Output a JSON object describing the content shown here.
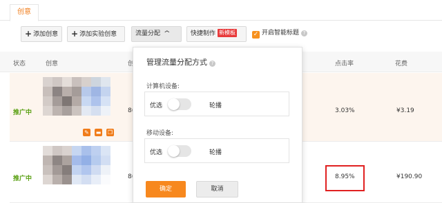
{
  "tabs": {
    "active": "创意"
  },
  "toolbar": {
    "add_creative": "添加创意",
    "add_experiment": "添加实验创意",
    "traffic_split": "流量分配",
    "quick_make": "快捷制作",
    "new_template_badge": "新模板",
    "smart_title": "开启智能标题"
  },
  "table": {
    "headers": {
      "status": "状态",
      "creative": "创意",
      "col_c": "创",
      "ctr": "点击率",
      "cost": "花费"
    },
    "rows": [
      {
        "status": "推广中",
        "col_c": "8(",
        "ctr": "3.03%",
        "cost": "¥3.19"
      },
      {
        "status": "推广中",
        "col_c": "8(",
        "ctr": "8.95%",
        "cost": "¥190.90"
      }
    ]
  },
  "popup": {
    "title": "管理流量分配方式",
    "computer_label": "计算机设备:",
    "mobile_label": "移动设备:",
    "option_preferred": "优选",
    "option_rotate": "轮播",
    "confirm": "确定",
    "cancel": "取消"
  },
  "colors": {
    "accent": "#f7881e",
    "status_green": "#5aa013",
    "highlight_red": "#e02020"
  }
}
